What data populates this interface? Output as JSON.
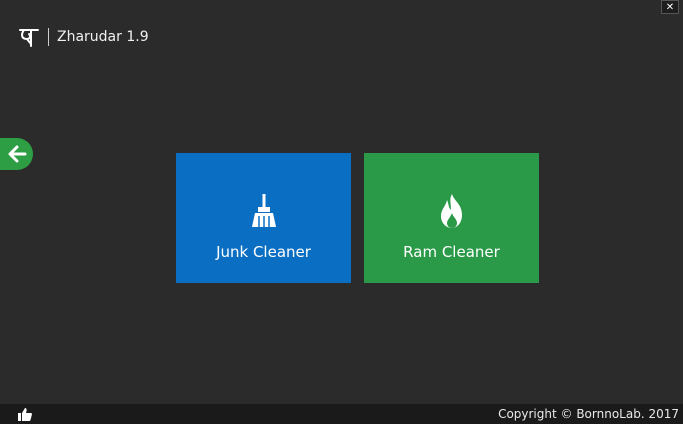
{
  "window": {
    "close_label": "✕"
  },
  "header": {
    "logo_icon": "bengali-letter-logo",
    "title": "Zharudar 1.9"
  },
  "nav": {
    "back_icon": "arrow-left-icon",
    "back_color": "#2e9e44"
  },
  "tiles": [
    {
      "label": "Junk Cleaner",
      "icon": "broom-icon",
      "color": "#0a6fc2"
    },
    {
      "label": "Ram Cleaner",
      "icon": "fire-icon",
      "color": "#2a9a48"
    }
  ],
  "footer": {
    "like_icon": "thumbs-up-icon",
    "copyright": "Copyright © BornnoLab. 2017"
  }
}
